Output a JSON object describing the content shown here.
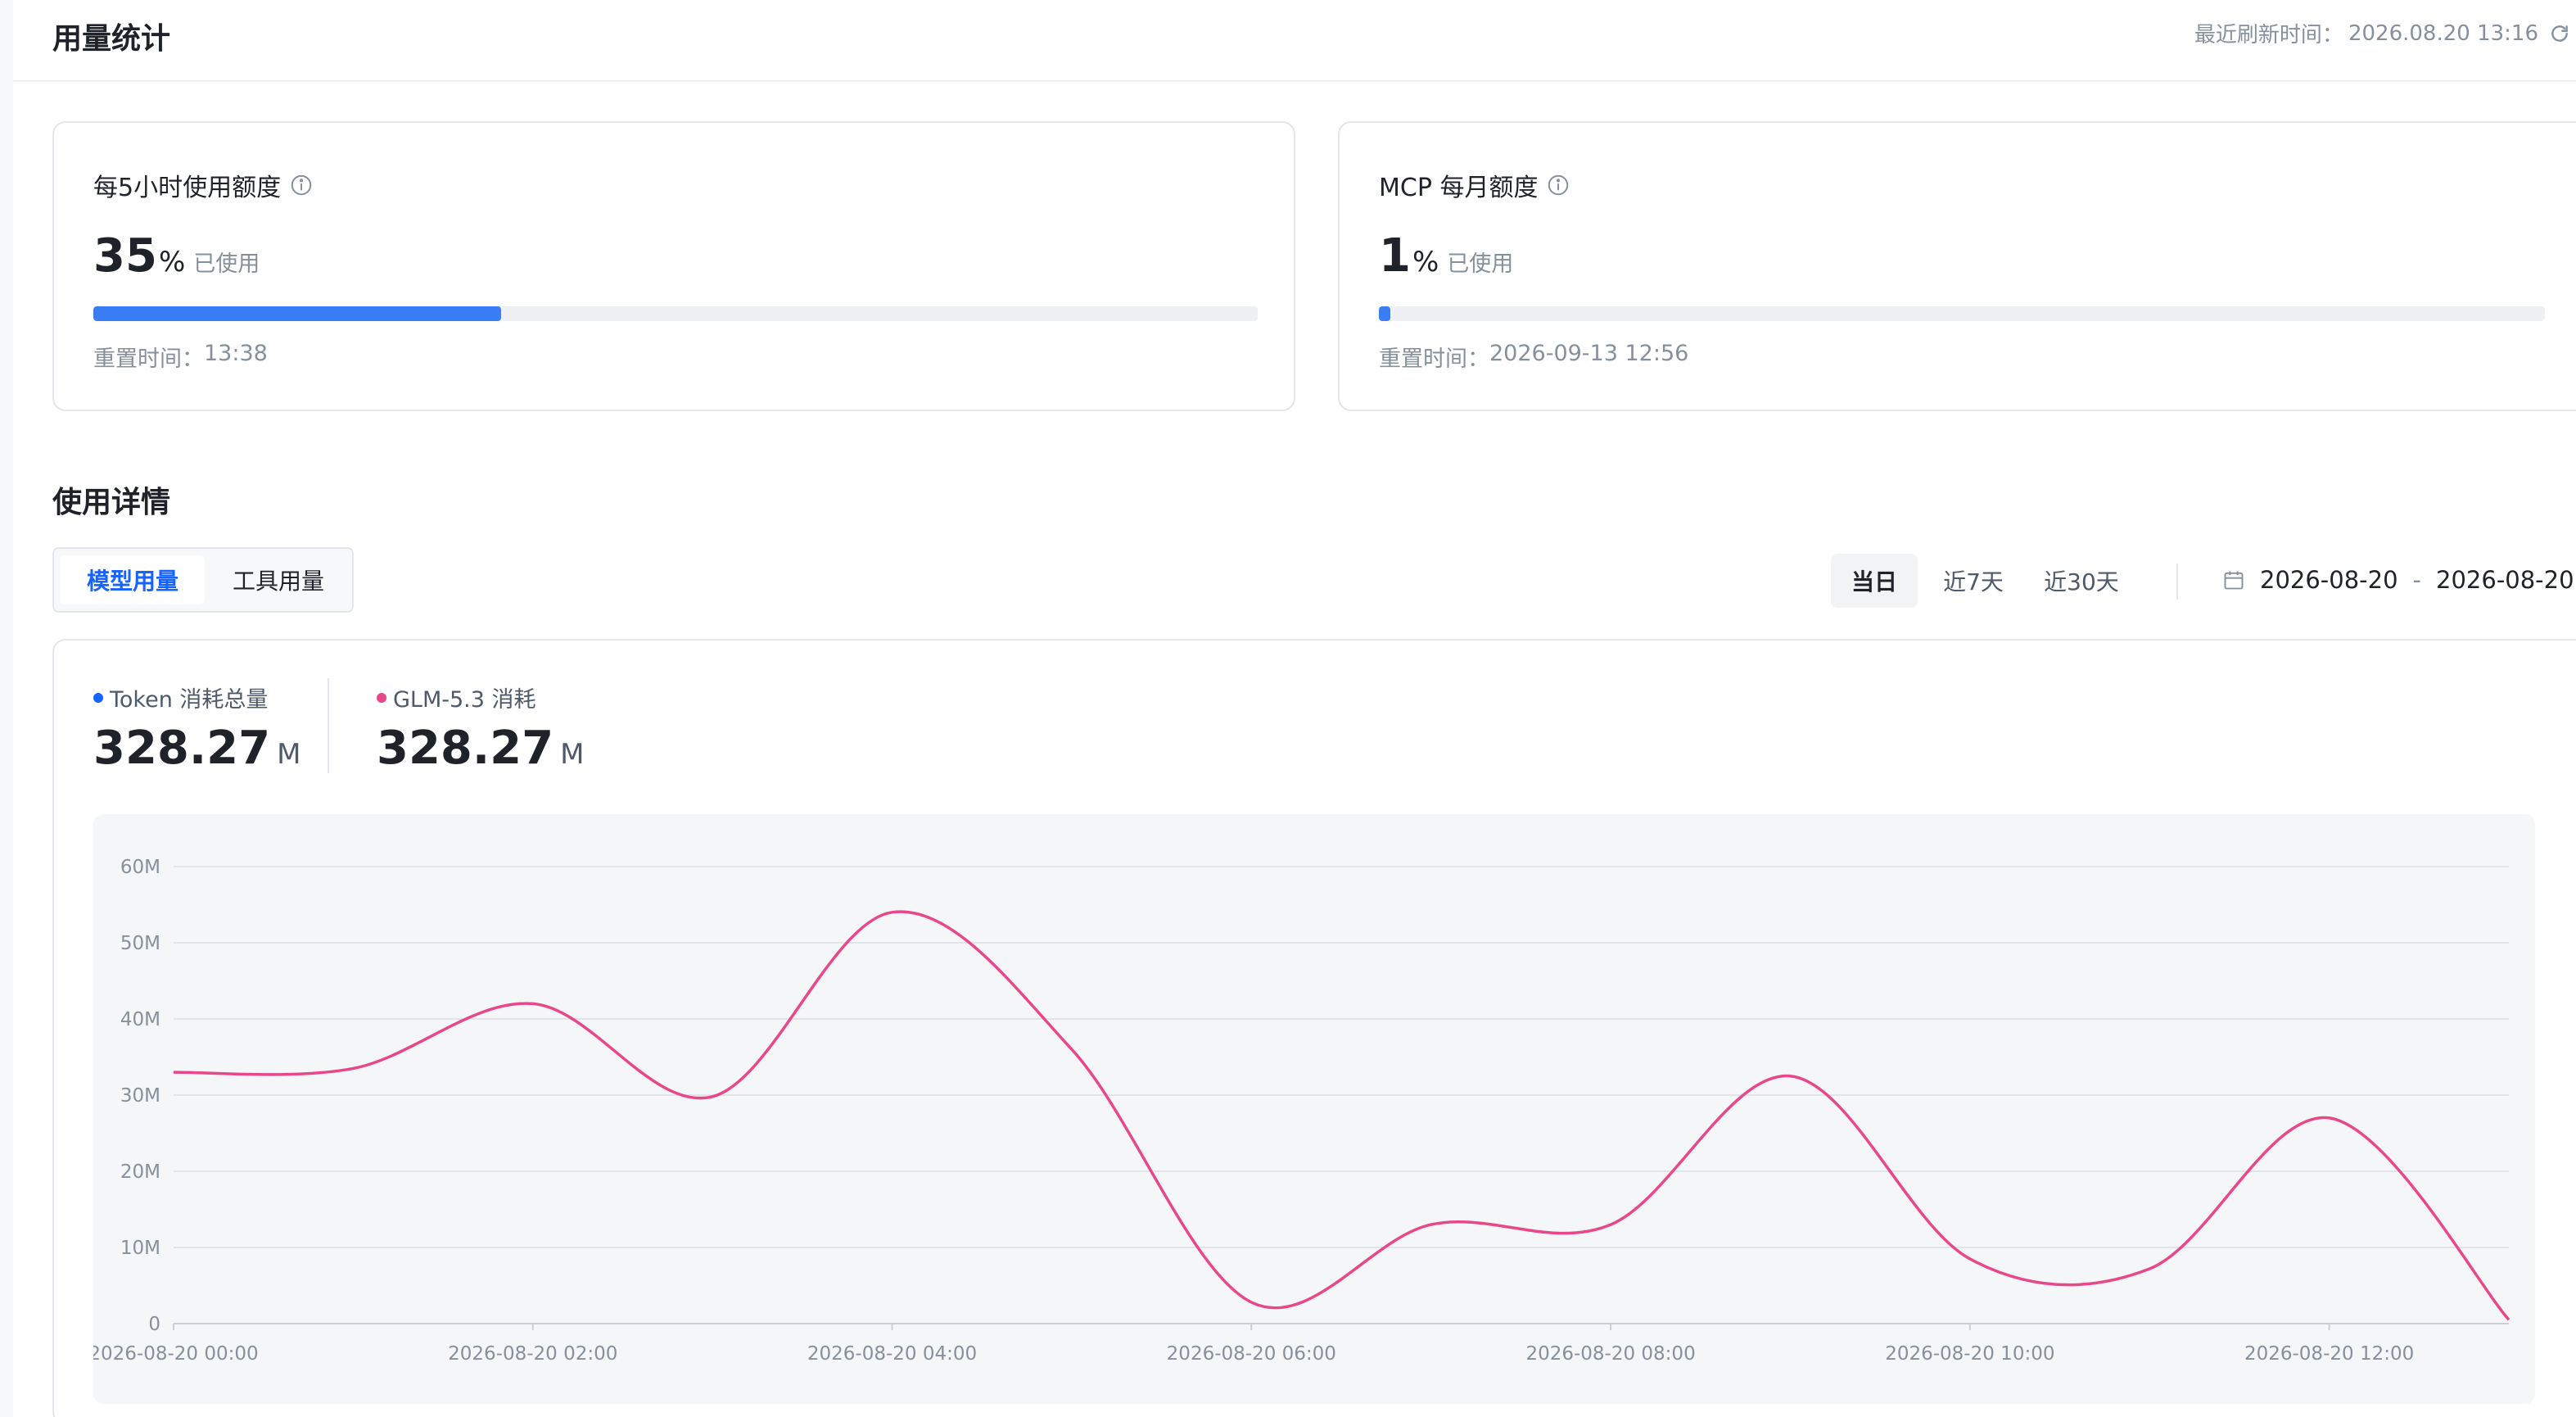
{
  "header": {
    "title": "用量统计",
    "refresh_label": "最近刷新时间：",
    "refresh_time": "2026.08.20 13:16",
    "refresh_icon": "refresh-icon"
  },
  "quotas": [
    {
      "title": "每5小时使用额度",
      "percent": "35",
      "percent_value": 35,
      "unit": "%",
      "used_label": "已使用",
      "reset_label": "重置时间：",
      "reset_time": "13:38",
      "bar_color": "#3a7ef5"
    },
    {
      "title": "MCP 每月额度",
      "percent": "1",
      "percent_value": 1,
      "unit": "%",
      "used_label": "已使用",
      "reset_label": "重置时间：",
      "reset_time": "2026-09-13 12:56",
      "bar_color": "#3a7ef5"
    }
  ],
  "details": {
    "title": "使用详情",
    "tabs": [
      {
        "label": "模型用量",
        "active": true
      },
      {
        "label": "工具用量",
        "active": false
      }
    ],
    "ranges": [
      {
        "label": "当日",
        "active": true
      },
      {
        "label": "近7天",
        "active": false
      },
      {
        "label": "近30天",
        "active": false
      }
    ],
    "date_start": "2026-08-20",
    "date_sep": "-",
    "date_end": "2026-08-20",
    "stats": [
      {
        "label": "Token 消耗总量",
        "value": "328.27",
        "unit": "M",
        "dot_color": "#1664ff"
      },
      {
        "label": "GLM-5.3 消耗",
        "value": "328.27",
        "unit": "M",
        "dot_color": "#e8488a"
      }
    ]
  },
  "chart_data": {
    "type": "line",
    "title": "",
    "xlabel": "",
    "ylabel": "",
    "y_ticks": [
      "0",
      "10M",
      "20M",
      "30M",
      "40M",
      "50M",
      "60M"
    ],
    "ylim": [
      0,
      60
    ],
    "y_unit": "M",
    "x_tick_labels": [
      "2026-08-20 00:00",
      "2026-08-20 02:00",
      "2026-08-20 04:00",
      "2026-08-20 06:00",
      "2026-08-20 08:00",
      "2026-08-20 10:00",
      "2026-08-20 12:00"
    ],
    "x_hours": [
      0,
      1,
      2,
      3,
      4,
      5,
      6,
      7,
      8,
      9,
      10,
      11,
      12,
      13
    ],
    "grid": true,
    "series": [
      {
        "name": "GLM-5.3",
        "color": "#e8488a",
        "values": [
          33.0,
          33.5,
          42.0,
          29.8,
          54.0,
          36.0,
          2.8,
          13.0,
          13.0,
          32.5,
          8.5,
          7.2,
          27.0,
          0.5
        ]
      }
    ]
  }
}
